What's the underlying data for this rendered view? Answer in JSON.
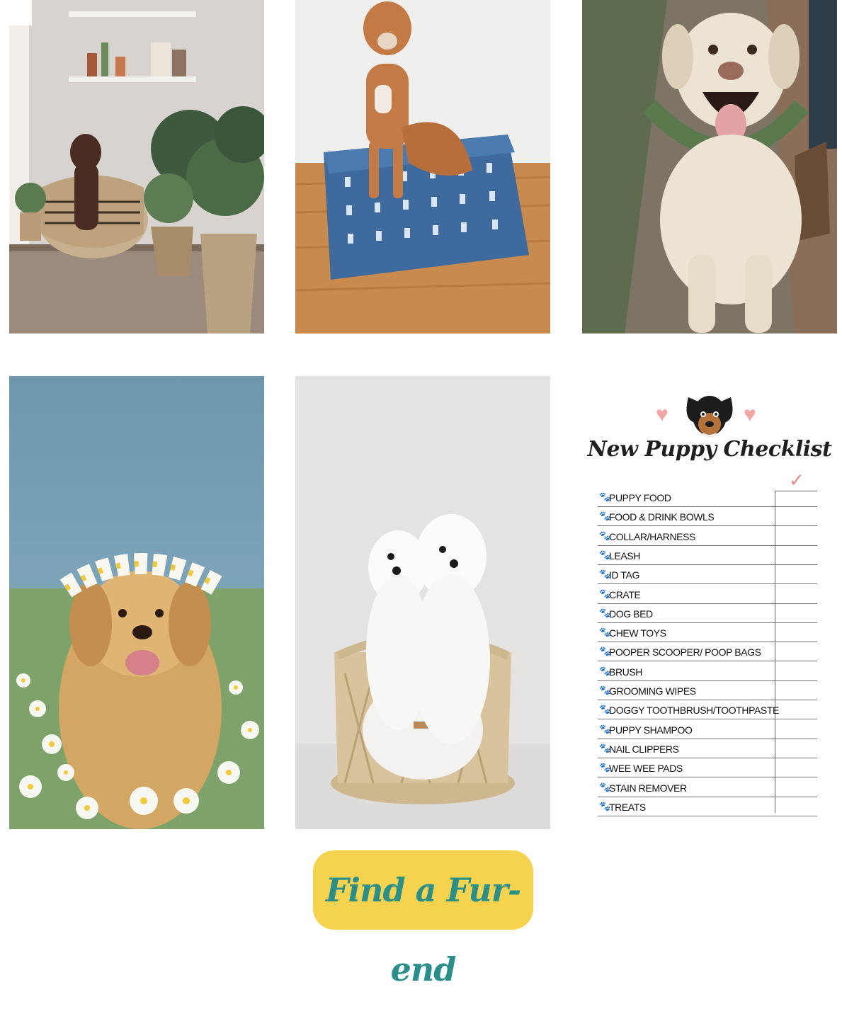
{
  "gallery": {
    "images": [
      {
        "alt": "Brown dog in woven basket bed with plants",
        "icon": "photo-dog-basket"
      },
      {
        "alt": "Curly dog on blue mudcloth cushion bed",
        "icon": "photo-dog-cushion"
      },
      {
        "alt": "Yellow labrador wearing greenery collar",
        "icon": "photo-labrador"
      },
      {
        "alt": "Golden retriever with daisy crown in field",
        "icon": "photo-golden-daisies"
      },
      {
        "alt": "Two white maltese dogs in rattan bed",
        "icon": "photo-maltese-pair"
      }
    ]
  },
  "checklist": {
    "title": "New Puppy Checklist",
    "check_mark": "✓",
    "paw": "🐾",
    "items": [
      "PUPPY FOOD",
      "FOOD & DRINK BOWLS",
      "COLLAR/HARNESS",
      "LEASH",
      "ID TAG",
      "CRATE",
      "DOG BED",
      "CHEW TOYS",
      "POOPER SCOOPER/ POOP BAGS",
      "BRUSH",
      "GROOMING WIPES",
      "DOGGY TOOTHBRUSH/TOOTHPASTE",
      "PUPPY SHAMPOO",
      "NAIL CLIPPERS",
      "WEE WEE PADS",
      "STAIN REMOVER",
      "TREATS"
    ]
  },
  "cta": {
    "label": "Find a Fur-end"
  },
  "colors": {
    "cta_bg": "#f6d34f",
    "cta_text": "#2a8f8a",
    "heart": "#f2a6a6",
    "check": "#e68a8a"
  }
}
